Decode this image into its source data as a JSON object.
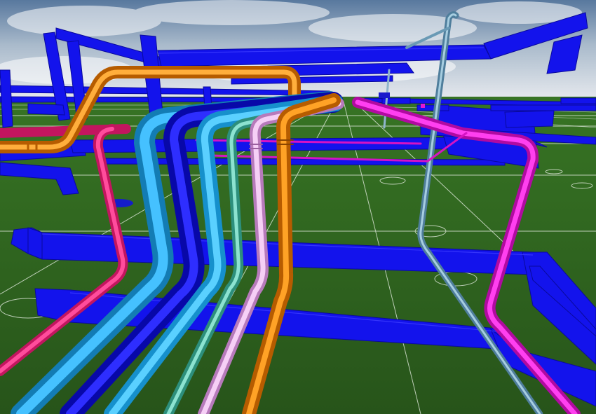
{
  "scene": {
    "colors": {
      "sky_top": "#5f7fa6",
      "sky_horizon": "#d8dde6",
      "ground": "#2a5a1c",
      "ground_far": "#316b22",
      "grid_line": "#cfd8cc",
      "structure_blue": "#1010e8",
      "structure_dark": "#08088a",
      "pipe_orange": "#f28a10",
      "pipe_magenta": "#e21ad0",
      "pipe_pink": "#ee2f86",
      "pipe_sky": "#2aa6e6",
      "pipe_blue": "#1b1bd6",
      "pipe_light_blue": "#39b2ec",
      "pipe_teal": "#4cbfa8",
      "pipe_lavender": "#e3a4e6",
      "pipe_steel": "#6d9fbd"
    }
  }
}
